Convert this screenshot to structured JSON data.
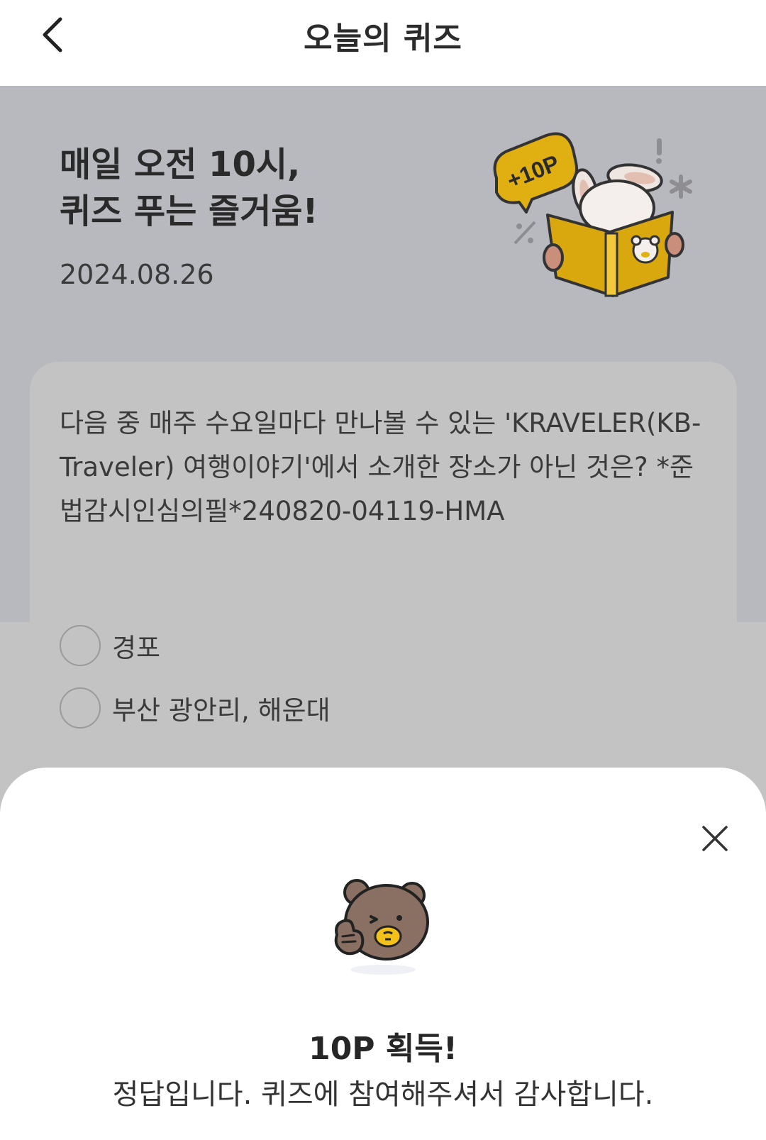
{
  "header": {
    "title": "오늘의 퀴즈",
    "back_icon": "chevron-left-icon"
  },
  "hero": {
    "title_line1": "매일 오전 10시,",
    "title_line2": "퀴즈 푸는 즐거움!",
    "date": "2024.08.26",
    "badge": "+10P"
  },
  "quiz": {
    "question": "다음 중 매주 수요일마다 만나볼 수 있는 'KRAVELER(KB-Traveler) 여행이야기'에서 소개한 장소가 아닌 것은? *준법감시인심의필*240820-04119-HMA",
    "options": [
      {
        "label": "경포"
      },
      {
        "label": "부산 광안리, 해운대"
      }
    ]
  },
  "result_sheet": {
    "title": "10P 획득!",
    "message": "정답입니다. 퀴즈에 참여해주셔서 감사합니다.",
    "close_icon": "close-icon"
  },
  "colors": {
    "hero_bg": "#b8b9be",
    "dim_bg": "#c3c3c3",
    "badge_yellow": "#e0b012",
    "book_yellow": "#d9a80f",
    "bear_brown": "#8a7063"
  }
}
